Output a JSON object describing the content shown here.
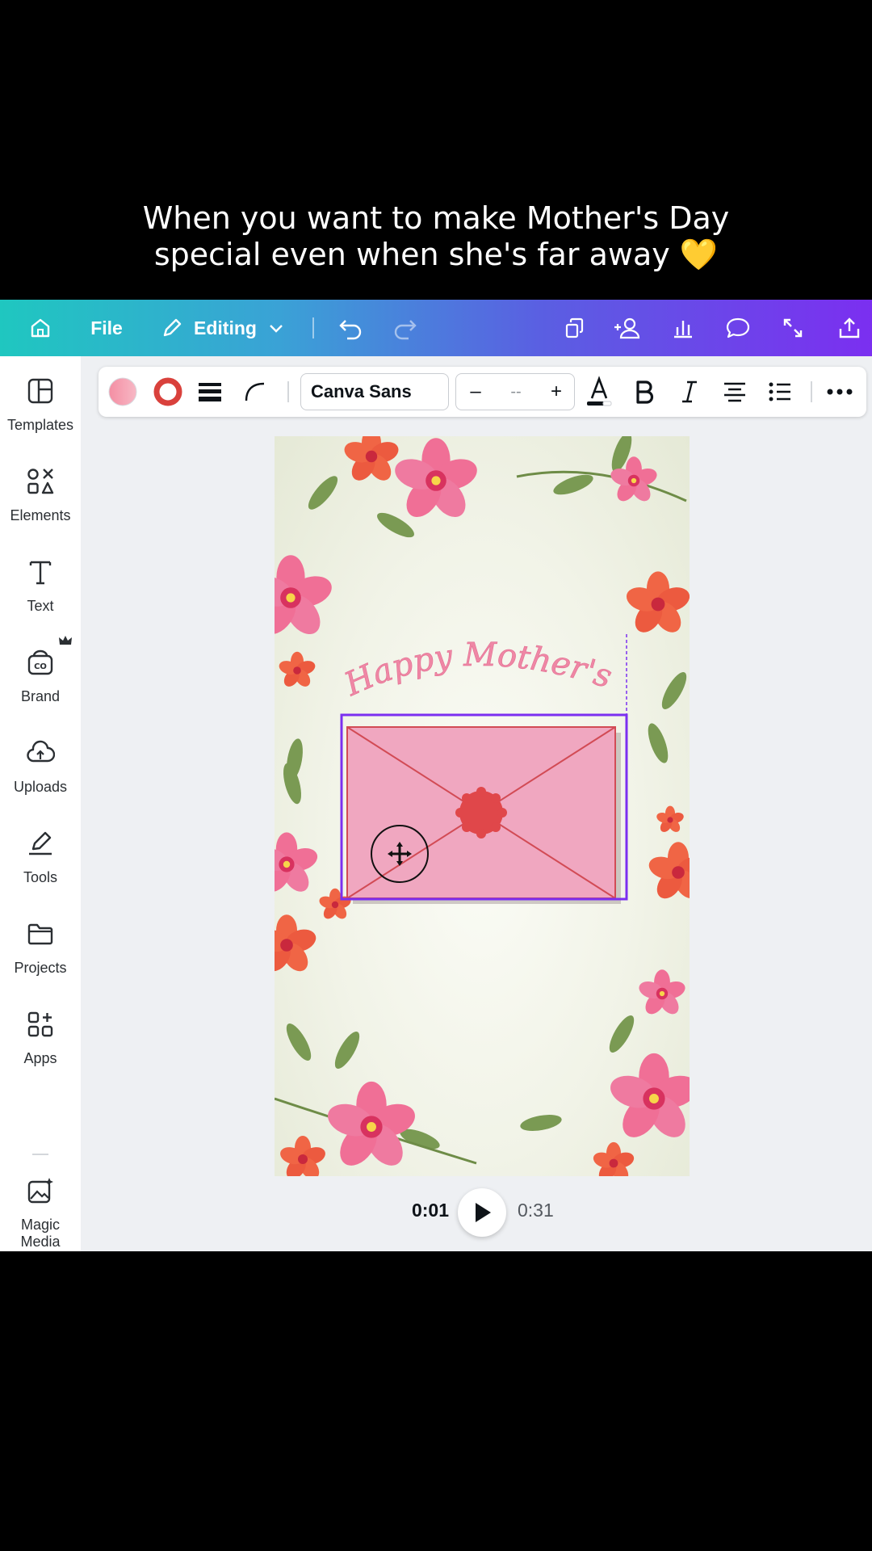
{
  "caption": {
    "line1": "When you want to make Mother's Day",
    "line2": "special even when she's far away 💛"
  },
  "topbar": {
    "file_label": "File",
    "editing_label": "Editing"
  },
  "sidebar": {
    "items": [
      {
        "label": "Templates",
        "icon": "templates-icon"
      },
      {
        "label": "Elements",
        "icon": "elements-icon"
      },
      {
        "label": "Text",
        "icon": "text-icon"
      },
      {
        "label": "Brand",
        "icon": "brand-icon"
      },
      {
        "label": "Uploads",
        "icon": "uploads-icon"
      },
      {
        "label": "Tools",
        "icon": "tools-icon"
      },
      {
        "label": "Projects",
        "icon": "projects-icon"
      },
      {
        "label": "Apps",
        "icon": "apps-icon"
      },
      {
        "label": "Magic Media",
        "icon": "magic-media-icon"
      },
      {
        "label": "",
        "icon": "music-icon"
      }
    ]
  },
  "toolbar": {
    "font_name": "Canva Sans",
    "font_size": "--",
    "decrease": "–",
    "increase": "+",
    "fill_color": "#f4a3b2",
    "stroke_color": "#d9413c"
  },
  "canvas": {
    "headline": "Happy Mother's Day!",
    "envelope_color": "#f0a7c0",
    "seal_color": "#e0474a",
    "selection_color": "#7b2ff0"
  },
  "playback": {
    "current_time": "0:01",
    "total_time": "0:31"
  }
}
